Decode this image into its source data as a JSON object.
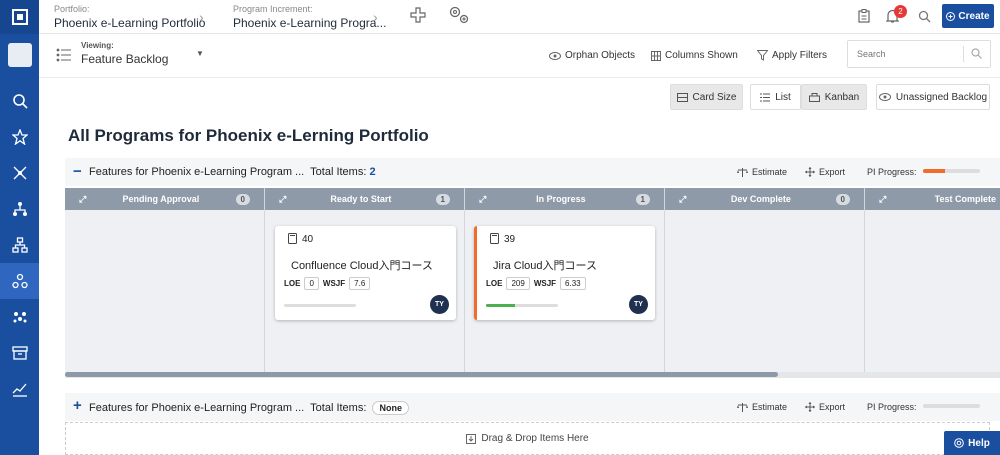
{
  "topbar": {
    "portfolio_label": "Portfolio:",
    "portfolio_value": "Phoenix e-Learning Portfolio",
    "increment_label": "Program Increment:",
    "increment_value": "Phoenix e-Learning Progra...",
    "notification_count": "2",
    "create_label": "Create"
  },
  "toolbar": {
    "viewing_label": "Viewing:",
    "viewing_value": "Feature Backlog",
    "orphan_objects": "Orphan Objects",
    "columns_shown": "Columns Shown",
    "apply_filters": "Apply Filters",
    "search_placeholder": "Search"
  },
  "viewbar": {
    "card_size": "Card Size",
    "list": "List",
    "kanban": "Kanban",
    "unassigned_backlog": "Unassigned Backlog"
  },
  "page_title": "All Programs for Phoenix e-Lerning Portfolio",
  "groups": [
    {
      "label": "Features for  Phoenix e-Learning Program ...",
      "total_label": "Total Items:",
      "total_value": "2",
      "estimate": "Estimate",
      "export": "Export",
      "pi_progress_label": "PI Progress:",
      "pi_progress_fraction": 0.38
    },
    {
      "label": "Features for  Phoenix e-Learning Program ...",
      "total_label": "Total Items:",
      "total_value": "None",
      "estimate": "Estimate",
      "export": "Export",
      "pi_progress_label": "PI Progress:",
      "pi_progress_fraction": 0
    }
  ],
  "columns": [
    {
      "title": "Pending Approval",
      "count": "0"
    },
    {
      "title": "Ready to Start",
      "count": "1"
    },
    {
      "title": "In Progress",
      "count": "1"
    },
    {
      "title": "Dev Complete",
      "count": "0"
    },
    {
      "title": "Test Complete",
      "count": ""
    }
  ],
  "cards": [
    {
      "id": "40",
      "name": "Confluence Cloud入門コース",
      "loe_label": "LOE",
      "loe": "0",
      "wsjf_label": "WSJF",
      "wsjf": "7.6",
      "owner": "TY",
      "progress_fraction": 0
    },
    {
      "id": "39",
      "name": "Jira Cloud入門コース",
      "loe_label": "LOE",
      "loe": "209",
      "wsjf_label": "WSJF",
      "wsjf": "6.33",
      "owner": "TY",
      "progress_fraction": 0.4
    }
  ],
  "drop_zone": "Drag & Drop Items Here",
  "help_label": "Help",
  "colors": {
    "brand": "#1a4fa0",
    "accent_orange": "#ef6c2c",
    "progress_green": "#4caf50",
    "column_header": "#8e9aa8"
  }
}
